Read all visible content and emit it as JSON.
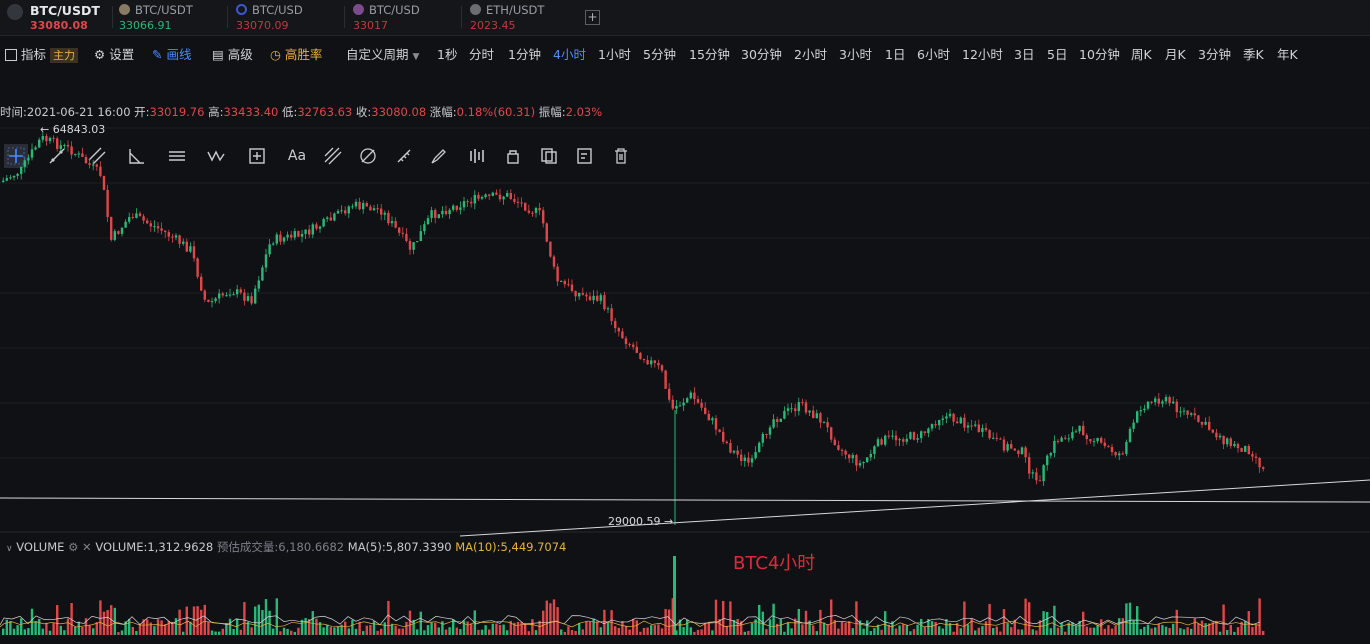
{
  "tickers": [
    {
      "symbol": "BTC/USDT",
      "price": "33080.08",
      "price_color": "#e0464a",
      "active": true,
      "icon_color": "#3b3e45"
    },
    {
      "symbol": "BTC/USDT",
      "price": "33066.91",
      "price_color": "#26b97a",
      "active": false,
      "icon_color": "#8a7a63"
    },
    {
      "symbol": "BTC/USD",
      "price": "33070.09",
      "price_color": "#c0393e",
      "active": false,
      "icon_color": "#3a57d6"
    },
    {
      "symbol": "BTC/USD",
      "price": "33017",
      "price_color": "#c0393e",
      "active": false,
      "icon_color": "#7d4a8e"
    },
    {
      "symbol": "ETH/USDT",
      "price": "2023.45",
      "price_color": "#c0393e",
      "active": false,
      "icon_color": "#6b6d73"
    }
  ],
  "add_tab_label": "+",
  "toolbar": {
    "indicator_label": "指标",
    "main_badge": "主力",
    "settings_label": "设置",
    "draw_label": "画线",
    "advanced_label": "高级",
    "winrate_label": "高胜率",
    "custom_period_label": "自定义周期",
    "periods": [
      "1秒",
      "分时",
      "1分钟",
      "4小时",
      "1小时",
      "5分钟",
      "15分钟",
      "30分钟",
      "2小时",
      "3小时",
      "1日",
      "6小时",
      "12小时",
      "3日",
      "5日",
      "10分钟",
      "周K",
      "月K",
      "3分钟",
      "季K",
      "年K"
    ],
    "active_period": "4小时"
  },
  "draw_tools": [
    "crosshair-icon",
    "line-icon",
    "parallel-lines-icon",
    "angle-icon",
    "hlines-icon",
    "wave-icon",
    "measure-icon",
    "text-icon",
    "fib-icon",
    "fib-circle-icon",
    "ruler-icon",
    "brush-icon",
    "pattern-icon",
    "lock-icon",
    "copy-icon",
    "edit-icon",
    "delete-icon"
  ],
  "info": {
    "time_label": "时间:",
    "time": "2021-06-21 16:00",
    "open_label": "开:",
    "open": "33019.76",
    "high_label": "高:",
    "high": "33433.40",
    "low_label": "低:",
    "low": "32763.63",
    "close_label": "收:",
    "close": "33080.08",
    "change_label": "涨幅:",
    "change": "0.18%(60.31)",
    "amp_label": "振幅:",
    "amp": "2.03%"
  },
  "chart_high_marker": "64843.03",
  "chart_low_marker": "29000.59",
  "volume": {
    "title": "VOLUME",
    "value_label": "VOLUME:",
    "value": "1,312.9628",
    "est_label": "预估成交量:",
    "est": "6,180.6682",
    "ma5_label": "MA(5):",
    "ma5": "5,807.3390",
    "ma10_label": "MA(10):",
    "ma10": "5,449.7074"
  },
  "annotation": "BTC4小时",
  "colors": {
    "up": "#26b97a",
    "down": "#e0464a",
    "active": "#4a8cff",
    "accent": "#e8b339"
  }
}
